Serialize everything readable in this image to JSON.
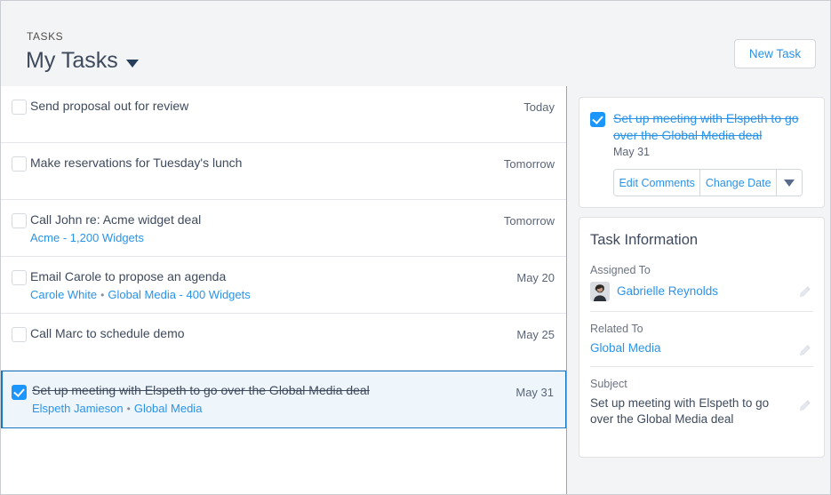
{
  "header": {
    "eyebrow": "TASKS",
    "title": "My Tasks",
    "caret_icon": "chevron-down-icon",
    "new_task_label": "New Task"
  },
  "accent_colors": {
    "link_blue": "#2a93e8",
    "checkbox_blue": "#1b96ff",
    "selected_border": "#1776c4",
    "selected_bg": "#eef6fc",
    "page_bg": "#f3f4f6",
    "text_dark": "#3e4a5c",
    "text_muted": "#6b7382"
  },
  "task_list": [
    {
      "title": "Send proposal out for review",
      "links": [],
      "date": "Today",
      "checked": false,
      "selected": false
    },
    {
      "title": "Make reservations for Tuesday's lunch",
      "links": [],
      "date": "Tomorrow",
      "checked": false,
      "selected": false
    },
    {
      "title": "Call John re: Acme widget deal",
      "links": [
        "Acme - 1,200 Widgets"
      ],
      "date": "Tomorrow",
      "checked": false,
      "selected": false
    },
    {
      "title": "Email Carole to propose an agenda",
      "links": [
        "Carole White",
        "Global Media - 400 Widgets"
      ],
      "date": "May 20",
      "checked": false,
      "selected": false
    },
    {
      "title": "Call Marc to schedule demo",
      "links": [],
      "date": "May 25",
      "checked": false,
      "selected": false
    },
    {
      "title": "Set up meeting with Elspeth to go over the Global Media deal",
      "links": [
        "Elspeth Jamieson",
        "Global Media"
      ],
      "date": "May 31",
      "checked": true,
      "selected": true
    }
  ],
  "detail": {
    "checked": true,
    "title": "Set up meeting with Elspeth to go over the Global Media deal",
    "date": "May 31",
    "edit_comments_label": "Edit Comments",
    "change_date_label": "Change Date",
    "more_actions_icon": "chevron-down-icon",
    "info_heading": "Task Information",
    "fields": [
      {
        "label": "Assigned To",
        "value": "Gabrielle Reynolds",
        "is_link": true,
        "has_avatar": true,
        "edit_icon": "pencil-icon"
      },
      {
        "label": "Related To",
        "value": "Global Media",
        "is_link": true,
        "has_avatar": false,
        "edit_icon": "pencil-icon"
      },
      {
        "label": "Subject",
        "value": "Set up meeting with Elspeth to go over the Global Media deal",
        "is_link": false,
        "has_avatar": false,
        "edit_icon": "pencil-icon"
      }
    ]
  }
}
